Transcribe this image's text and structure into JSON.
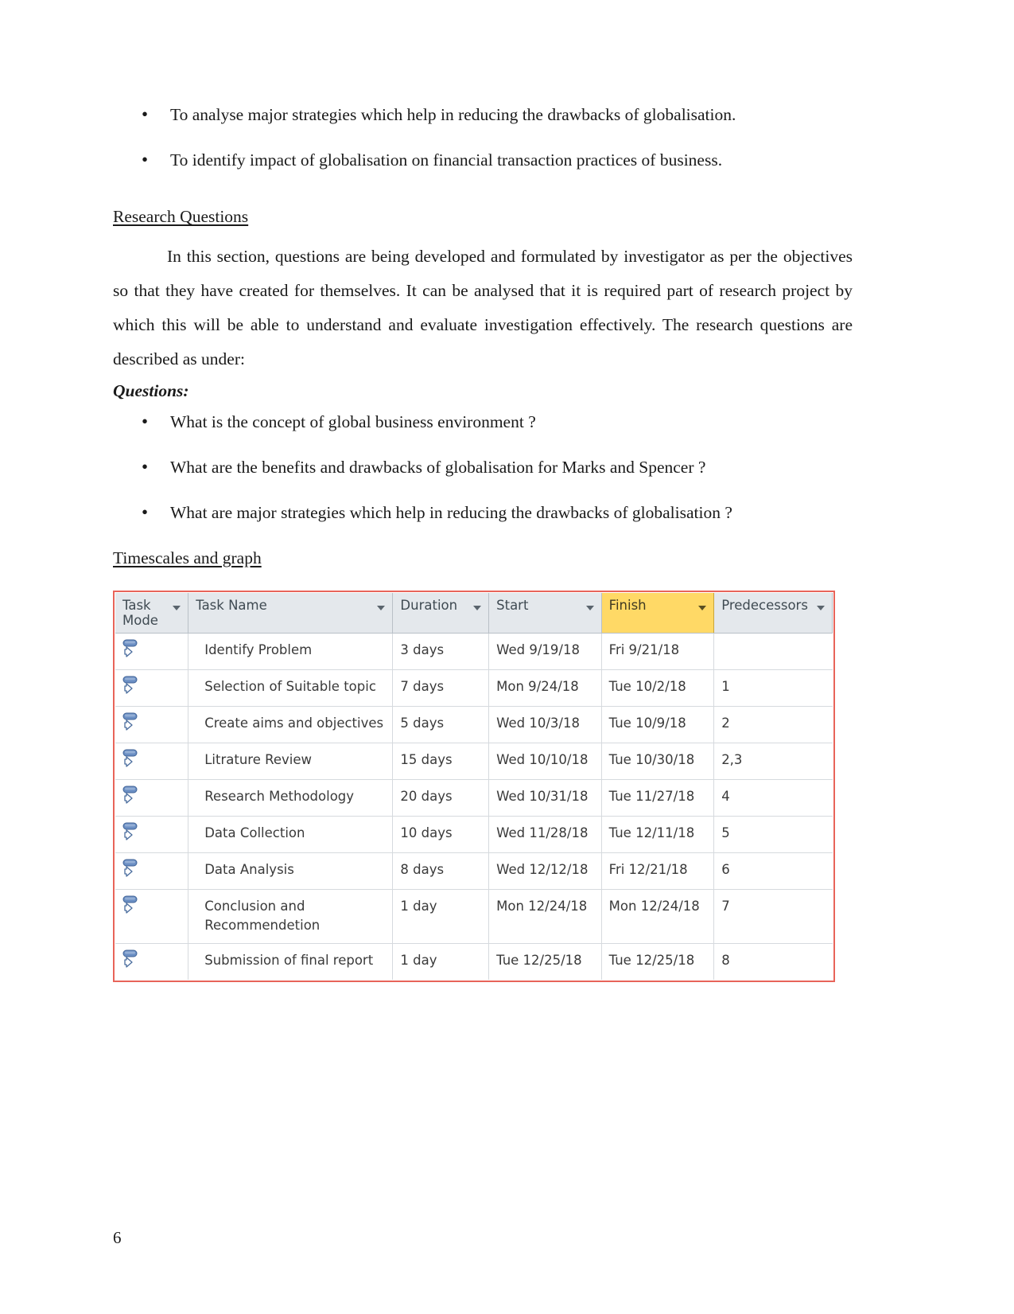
{
  "objectives_bullets": [
    {
      "text": "To analyse major strategies which help in reducing the drawbacks of globalisation.",
      "color": "#1a1a1a"
    },
    {
      "text": "To identify impact of globalisation on financial transaction practices of business.",
      "color": "#ee22aa"
    }
  ],
  "research_questions": {
    "heading": "Research Questions",
    "paragraph": "In this section, questions are being developed and formulated by investigator as per the objectives so that they have created for themselves. It can be analysed that it is required part of research project by which this will be able to understand and evaluate investigation effectively. The research questions are described as under:",
    "questions_label": "Questions:",
    "questions": [
      "What is the concept of global business environment ?",
      "What are the benefits and drawbacks of globalisation for Marks and Spencer ?",
      "What are major strategies which help in reducing the drawbacks of globalisation ?"
    ]
  },
  "timescales": {
    "heading": "Timescales and graph",
    "table": {
      "border_color": "#e8645a",
      "highlight_color": "#ffd966",
      "highlighted_column": "Finish",
      "columns": [
        {
          "label": "Task Mode",
          "key": "task_mode",
          "dropdown": true
        },
        {
          "label": "Task Name",
          "key": "task_name",
          "dropdown": true
        },
        {
          "label": "Duration",
          "key": "duration",
          "dropdown": true
        },
        {
          "label": "Start",
          "key": "start",
          "dropdown": true
        },
        {
          "label": "Finish",
          "key": "finish",
          "dropdown": true
        },
        {
          "label": "Predecessors",
          "key": "predecessors",
          "dropdown": true
        }
      ],
      "rows": [
        {
          "task_mode_icon": "auto-schedule-icon",
          "task_name": "Identify Problem",
          "duration": "3 days",
          "start": "Wed 9/19/18",
          "finish": "Fri 9/21/18",
          "predecessors": ""
        },
        {
          "task_mode_icon": "auto-schedule-icon",
          "task_name": "Selection of Suitable topic",
          "duration": "7 days",
          "start": "Mon 9/24/18",
          "finish": "Tue 10/2/18",
          "predecessors": "1"
        },
        {
          "task_mode_icon": "auto-schedule-icon",
          "task_name": "Create aims and objectives",
          "duration": "5 days",
          "start": "Wed 10/3/18",
          "finish": "Tue 10/9/18",
          "predecessors": "2"
        },
        {
          "task_mode_icon": "auto-schedule-icon",
          "task_name": "Litrature Review",
          "duration": "15 days",
          "start": "Wed 10/10/18",
          "finish": "Tue 10/30/18",
          "predecessors": "2,3"
        },
        {
          "task_mode_icon": "auto-schedule-icon",
          "task_name": "Research Methodology",
          "duration": "20 days",
          "start": "Wed 10/31/18",
          "finish": "Tue 11/27/18",
          "predecessors": "4"
        },
        {
          "task_mode_icon": "auto-schedule-icon",
          "task_name": "Data Collection",
          "duration": "10 days",
          "start": "Wed 11/28/18",
          "finish": "Tue 12/11/18",
          "predecessors": "5"
        },
        {
          "task_mode_icon": "auto-schedule-icon",
          "task_name": "Data Analysis",
          "duration": "8 days",
          "start": "Wed 12/12/18",
          "finish": "Fri 12/21/18",
          "predecessors": "6"
        },
        {
          "task_mode_icon": "auto-schedule-icon",
          "task_name": "Conclusion and Recommendetion",
          "duration": "1 day",
          "start": "Mon 12/24/18",
          "finish": "Mon 12/24/18",
          "predecessors": "7"
        },
        {
          "task_mode_icon": "auto-schedule-icon",
          "task_name": "Submission of final report",
          "duration": "1 day",
          "start": "Tue 12/25/18",
          "finish": "Tue 12/25/18",
          "predecessors": "8"
        }
      ]
    }
  },
  "footer": {
    "page_number": "6"
  }
}
